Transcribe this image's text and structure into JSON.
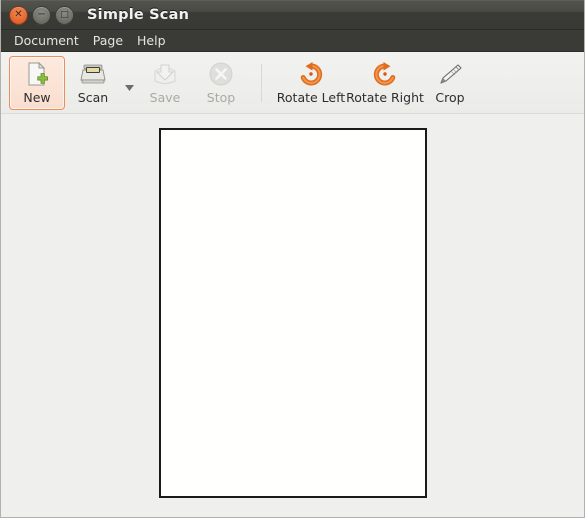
{
  "window": {
    "title": "Simple Scan",
    "controls": [
      {
        "name": "close",
        "glyph": "✕"
      },
      {
        "name": "minimize",
        "glyph": "−"
      },
      {
        "name": "maximize",
        "glyph": "□"
      }
    ]
  },
  "menubar": {
    "items": [
      {
        "label": "Document"
      },
      {
        "label": "Page"
      },
      {
        "label": "Help"
      }
    ]
  },
  "toolbar": {
    "buttons": [
      {
        "label": "New",
        "icon": "new-document-icon",
        "enabled": true,
        "active": true
      },
      {
        "label": "Scan",
        "icon": "scanner-icon",
        "enabled": true,
        "active": false
      },
      {
        "label": "Save",
        "icon": "save-icon",
        "enabled": false,
        "active": false
      },
      {
        "label": "Stop",
        "icon": "stop-icon",
        "enabled": false,
        "active": false
      },
      {
        "label": "Rotate Left",
        "icon": "rotate-left-icon",
        "enabled": true,
        "active": false
      },
      {
        "label": "Rotate Right",
        "icon": "rotate-right-icon",
        "enabled": true,
        "active": false
      },
      {
        "label": "Crop",
        "icon": "crop-icon",
        "enabled": true,
        "active": false
      }
    ],
    "scan_dropdown_icon": "chevron-down-icon"
  },
  "content": {
    "page_preview": "blank-scanned-page"
  },
  "colors": {
    "accent": "#e8703a",
    "titlebar": "#3b3b37",
    "menubar": "#3a3a36",
    "toolbar": "#eeeeeb",
    "workspace": "#eff0ee",
    "page": "#fffffd",
    "highlight_border": "#ec8d5f"
  }
}
